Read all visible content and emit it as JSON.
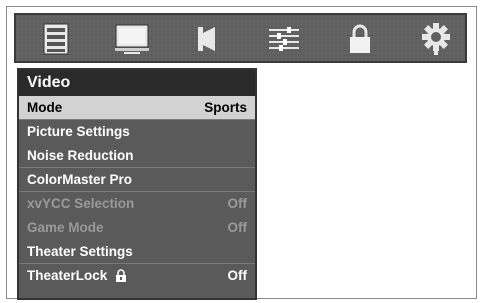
{
  "icon_bar": {
    "items": [
      {
        "icon": "setup-list-icon"
      },
      {
        "icon": "video-display-icon"
      },
      {
        "icon": "audio-speaker-icon"
      },
      {
        "icon": "preferences-sliders-icon"
      },
      {
        "icon": "lock-icon"
      },
      {
        "icon": "settings-gear-icon"
      }
    ]
  },
  "menu": {
    "title": "Video",
    "items": [
      {
        "label": "Mode",
        "value": "Sports",
        "state": "selected"
      },
      {
        "label": "Picture Settings",
        "value": "",
        "state": "normal"
      },
      {
        "label": "Noise Reduction",
        "value": "",
        "state": "normal"
      },
      {
        "label": "ColorMaster Pro",
        "value": "",
        "state": "normal"
      },
      {
        "label": "xvYCC Selection",
        "value": "Off",
        "state": "disabled"
      },
      {
        "label": "Game Mode",
        "value": "Off",
        "state": "disabled"
      },
      {
        "label": "Theater Settings",
        "value": "",
        "state": "normal"
      },
      {
        "label": "TheaterLock",
        "value": "Off",
        "state": "normal"
      }
    ]
  },
  "colors": {
    "menu_bg": "#5a5a5a",
    "title_bg": "#2a2a2a",
    "selected_bg": "#d2d2d2",
    "disabled_text": "#9a9a9a"
  }
}
